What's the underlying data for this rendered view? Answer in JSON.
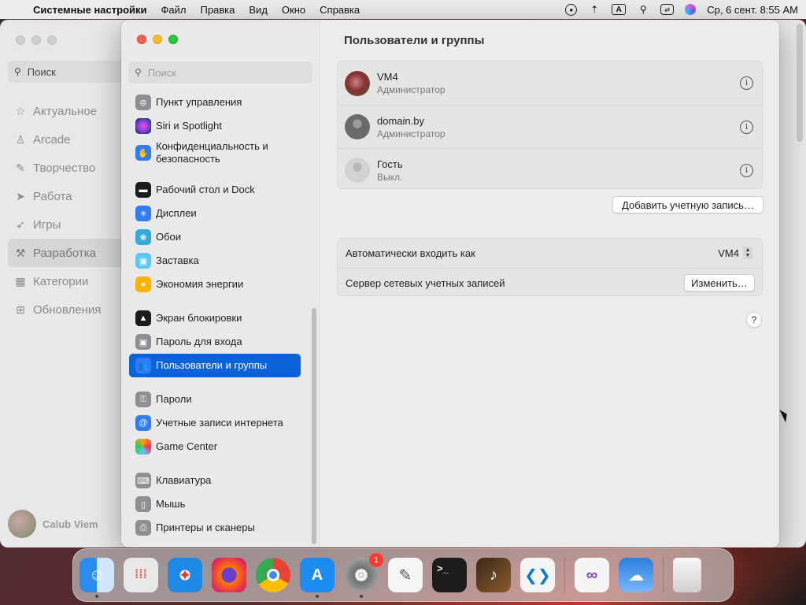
{
  "menubar": {
    "app_name": "Системные настройки",
    "menus": [
      "Файл",
      "Правка",
      "Вид",
      "Окно",
      "Справка"
    ],
    "input_indicator": "A",
    "datetime": "Ср, 6 сент.  8:55 AM"
  },
  "background_window": {
    "search_label": "Поиск",
    "nav": [
      {
        "label": "Актуальное",
        "icon": "star-icon"
      },
      {
        "label": "Arcade",
        "icon": "joystick-icon"
      },
      {
        "label": "Творчество",
        "icon": "brush-icon"
      },
      {
        "label": "Работа",
        "icon": "paper-plane-icon"
      },
      {
        "label": "Игры",
        "icon": "rocket-icon"
      },
      {
        "label": "Разработка",
        "icon": "hammer-icon"
      },
      {
        "label": "Категории",
        "icon": "grid-icon"
      },
      {
        "label": "Обновления",
        "icon": "download-icon"
      }
    ],
    "active_nav": "Разработка",
    "user_name": "Calub Viem"
  },
  "sidebar": {
    "search_placeholder": "Поиск",
    "items": [
      {
        "label": "Пункт управления",
        "icon": "control-center-icon",
        "color": "#8e8e93"
      },
      {
        "label": "Siri и Spotlight",
        "icon": "siri-icon",
        "color": "#5b3fd1"
      },
      {
        "label": "Конфиденциальность и безопасность",
        "icon": "hand-icon",
        "color": "#2f7cf6"
      },
      {
        "label": "Рабочий стол и Dock",
        "icon": "dock-icon",
        "color": "#1c1c1e"
      },
      {
        "label": "Дисплеи",
        "icon": "brightness-icon",
        "color": "#2f7cf6"
      },
      {
        "label": "Обои",
        "icon": "flower-icon",
        "color": "#34aadc"
      },
      {
        "label": "Заставка",
        "icon": "screensaver-icon",
        "color": "#5ac8fa"
      },
      {
        "label": "Экономия энергии",
        "icon": "lightbulb-icon",
        "color": "#ffb300"
      },
      {
        "label": "Экран блокировки",
        "icon": "lock-icon",
        "color": "#1c1c1e"
      },
      {
        "label": "Пароль для входа",
        "icon": "padlock-icon",
        "color": "#8e8e93"
      },
      {
        "label": "Пользователи и группы",
        "icon": "users-icon",
        "color": "#2f7cf6"
      },
      {
        "label": "Пароли",
        "icon": "key-icon",
        "color": "#8e8e93"
      },
      {
        "label": "Учетные записи интернета",
        "icon": "at-icon",
        "color": "#2f7cf6"
      },
      {
        "label": "Game Center",
        "icon": "game-center-icon",
        "color": "#ff9f0a"
      },
      {
        "label": "Клавиатура",
        "icon": "keyboard-icon",
        "color": "#8e8e93"
      },
      {
        "label": "Мышь",
        "icon": "mouse-icon",
        "color": "#8e8e93"
      },
      {
        "label": "Принтеры и сканеры",
        "icon": "printer-icon",
        "color": "#8e8e93"
      }
    ],
    "active_item": "Пользователи и группы"
  },
  "main": {
    "title": "Пользователи и группы",
    "users": [
      {
        "name": "VM4",
        "role": "Администратор"
      },
      {
        "name": "domain.by",
        "role": "Администратор"
      },
      {
        "name": "Гость",
        "role": "Выкл."
      }
    ],
    "add_account_button": "Добавить учетную запись…",
    "auto_login_label": "Автоматически входить как",
    "auto_login_value": "VM4",
    "network_server_label": "Сервер сетевых учетных записей",
    "change_button": "Изменить…",
    "help_button": "?"
  },
  "dock": {
    "apps": [
      {
        "name": "Finder",
        "running": true
      },
      {
        "name": "Launchpad",
        "running": false
      },
      {
        "name": "Safari",
        "running": false
      },
      {
        "name": "Firefox",
        "running": false
      },
      {
        "name": "Chrome",
        "running": false
      },
      {
        "name": "App Store",
        "running": true
      },
      {
        "name": "System Settings",
        "running": true,
        "badge": "1"
      },
      {
        "name": "TextEdit",
        "running": false
      },
      {
        "name": "Terminal",
        "running": false
      },
      {
        "name": "GarageBand",
        "running": false
      },
      {
        "name": "VS Code",
        "running": false
      },
      {
        "name": "Visual Studio",
        "running": false
      },
      {
        "name": "Weather",
        "running": false
      },
      {
        "name": "Trash",
        "running": false
      }
    ]
  }
}
